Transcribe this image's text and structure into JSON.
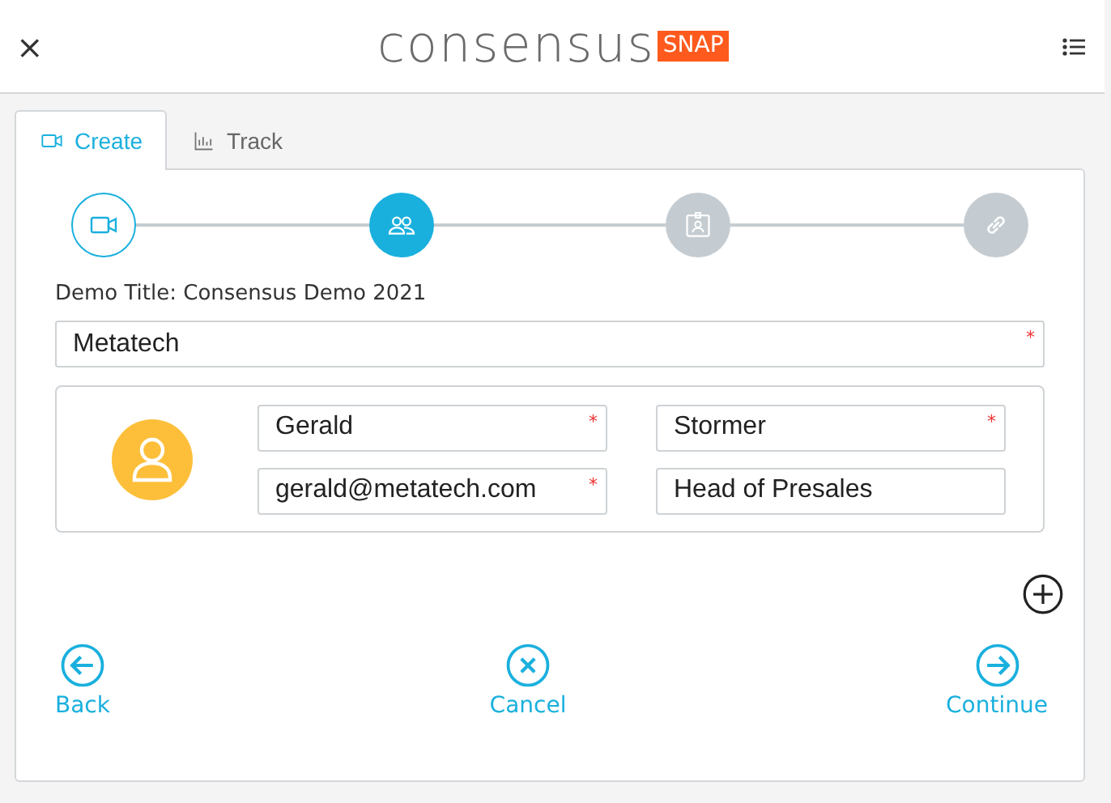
{
  "header": {
    "close": "×",
    "logo": "consensus",
    "logo_badge": "SNAP"
  },
  "tabs": [
    {
      "label": "Create",
      "selected": true
    },
    {
      "label": "Track",
      "selected": false
    }
  ],
  "steps": [
    {
      "completed": true,
      "selected": false
    },
    {
      "completed": false,
      "selected": true
    },
    {
      "completed": false,
      "selected": false
    },
    {
      "completed": false,
      "selected": false
    }
  ],
  "demo_title": "Demo Title: Consensus Demo 2021",
  "company": {
    "value": "Metatech",
    "required_mark": "*"
  },
  "contact": {
    "fields": [
      {
        "value": "Gerald",
        "required_mark": "*"
      },
      {
        "value": "Stormer",
        "required_mark": "*"
      },
      {
        "value": "gerald@metatech.com",
        "required_mark": "*"
      },
      {
        "value": "Head of Presales"
      }
    ]
  },
  "actions": [
    {
      "label": "Back",
      "kind": "back"
    },
    {
      "label": "Cancel",
      "kind": "cancel"
    },
    {
      "label": "Continue",
      "kind": "continue"
    }
  ]
}
